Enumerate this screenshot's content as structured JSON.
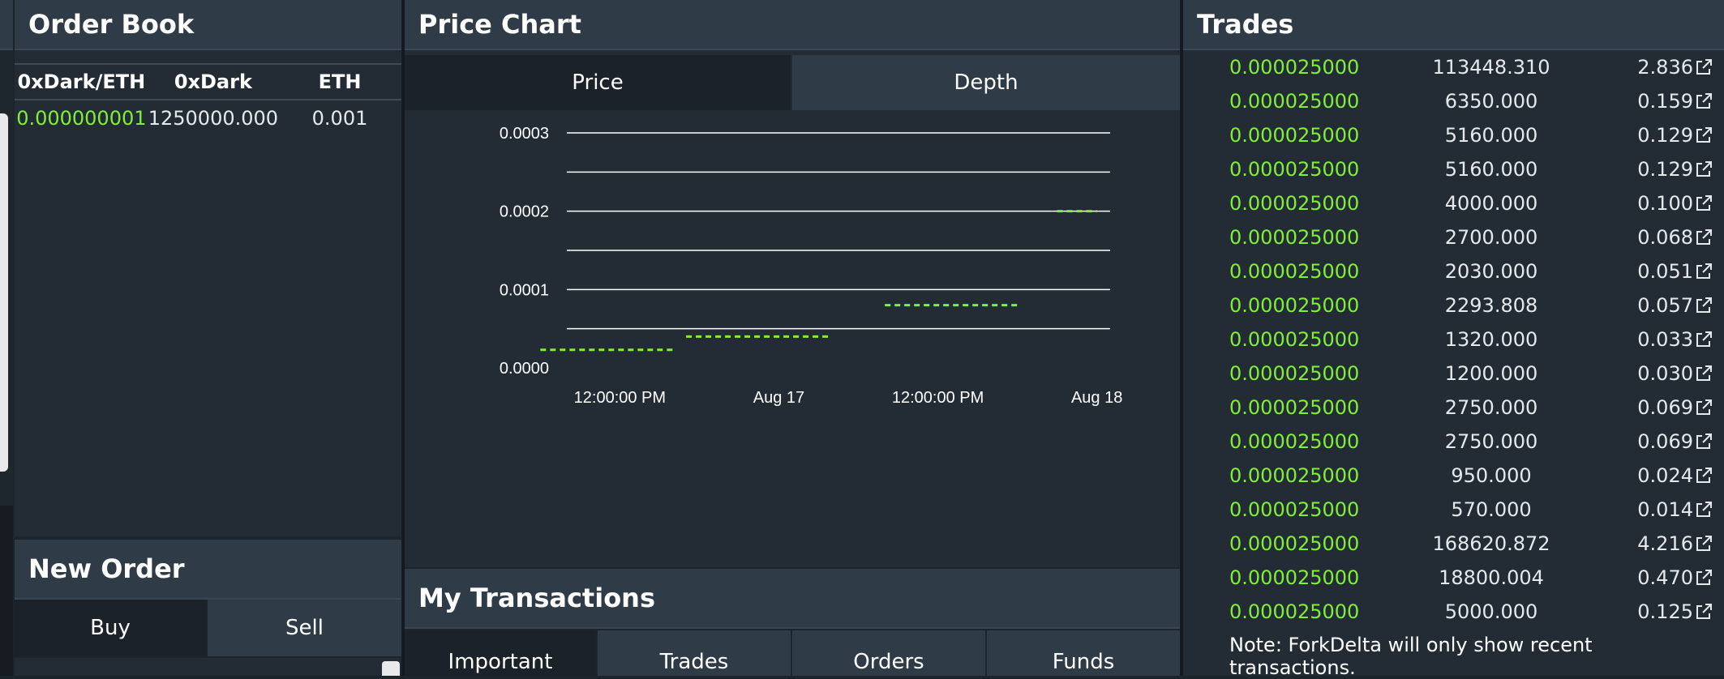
{
  "order_book": {
    "title": "Order Book",
    "columns": [
      "0xDark/ETH",
      "0xDark",
      "ETH"
    ],
    "rows": [
      {
        "price": "0.000000001",
        "amount": "1250000.000",
        "eth": "0.001"
      }
    ]
  },
  "new_order": {
    "title": "New Order",
    "tabs": [
      "Buy",
      "Sell"
    ]
  },
  "price_chart": {
    "title": "Price Chart",
    "tabs": [
      "Price",
      "Depth"
    ]
  },
  "chart_data": {
    "type": "line",
    "title": "",
    "xlabel": "",
    "ylabel": "",
    "ylim": [
      0,
      0.0003
    ],
    "y_ticks": [
      "0.0003",
      "0.0002",
      "0.0001",
      "0.0000"
    ],
    "x_ticks": [
      "12:00:00 PM",
      "Aug 17",
      "12:00:00 PM",
      "Aug 18"
    ],
    "grid": true,
    "line_color": "#80f037",
    "series": [
      {
        "segments": [
          {
            "x": [
              "Aug 16 06:00",
              "Aug 16 16:00"
            ],
            "y": [
              2.3e-05,
              2.3e-05
            ]
          },
          {
            "x": [
              "Aug 16 17:00",
              "Aug 17 04:00"
            ],
            "y": [
              4e-05,
              4e-05
            ]
          },
          {
            "x": [
              "Aug 17 08:00",
              "Aug 17 18:00"
            ],
            "y": [
              8e-05,
              8e-05
            ]
          },
          {
            "x": [
              "Aug 17 21:00",
              "Aug 18 00:00"
            ],
            "y": [
              0.0002,
              0.0002
            ]
          }
        ]
      }
    ]
  },
  "my_transactions": {
    "title": "My Transactions",
    "tabs": [
      "Important",
      "Trades",
      "Orders",
      "Funds"
    ]
  },
  "trades": {
    "title": "Trades",
    "rows": [
      {
        "price": "0.000025000",
        "amount": "113448.310",
        "eth": "2.836"
      },
      {
        "price": "0.000025000",
        "amount": "6350.000",
        "eth": "0.159"
      },
      {
        "price": "0.000025000",
        "amount": "5160.000",
        "eth": "0.129"
      },
      {
        "price": "0.000025000",
        "amount": "5160.000",
        "eth": "0.129"
      },
      {
        "price": "0.000025000",
        "amount": "4000.000",
        "eth": "0.100"
      },
      {
        "price": "0.000025000",
        "amount": "2700.000",
        "eth": "0.068"
      },
      {
        "price": "0.000025000",
        "amount": "2030.000",
        "eth": "0.051"
      },
      {
        "price": "0.000025000",
        "amount": "2293.808",
        "eth": "0.057"
      },
      {
        "price": "0.000025000",
        "amount": "1320.000",
        "eth": "0.033"
      },
      {
        "price": "0.000025000",
        "amount": "1200.000",
        "eth": "0.030"
      },
      {
        "price": "0.000025000",
        "amount": "2750.000",
        "eth": "0.069"
      },
      {
        "price": "0.000025000",
        "amount": "2750.000",
        "eth": "0.069"
      },
      {
        "price": "0.000025000",
        "amount": "950.000",
        "eth": "0.024"
      },
      {
        "price": "0.000025000",
        "amount": "570.000",
        "eth": "0.014"
      },
      {
        "price": "0.000025000",
        "amount": "168620.872",
        "eth": "4.216"
      },
      {
        "price": "0.000025000",
        "amount": "18800.004",
        "eth": "0.470"
      },
      {
        "price": "0.000025000",
        "amount": "5000.000",
        "eth": "0.125"
      }
    ],
    "note": "Note: ForkDelta will only show recent transactions.",
    "icon": "external-link-icon"
  },
  "colors": {
    "buy_green": "#80f037",
    "panel_bg": "#232c35",
    "title_bg": "#2f3b46"
  }
}
